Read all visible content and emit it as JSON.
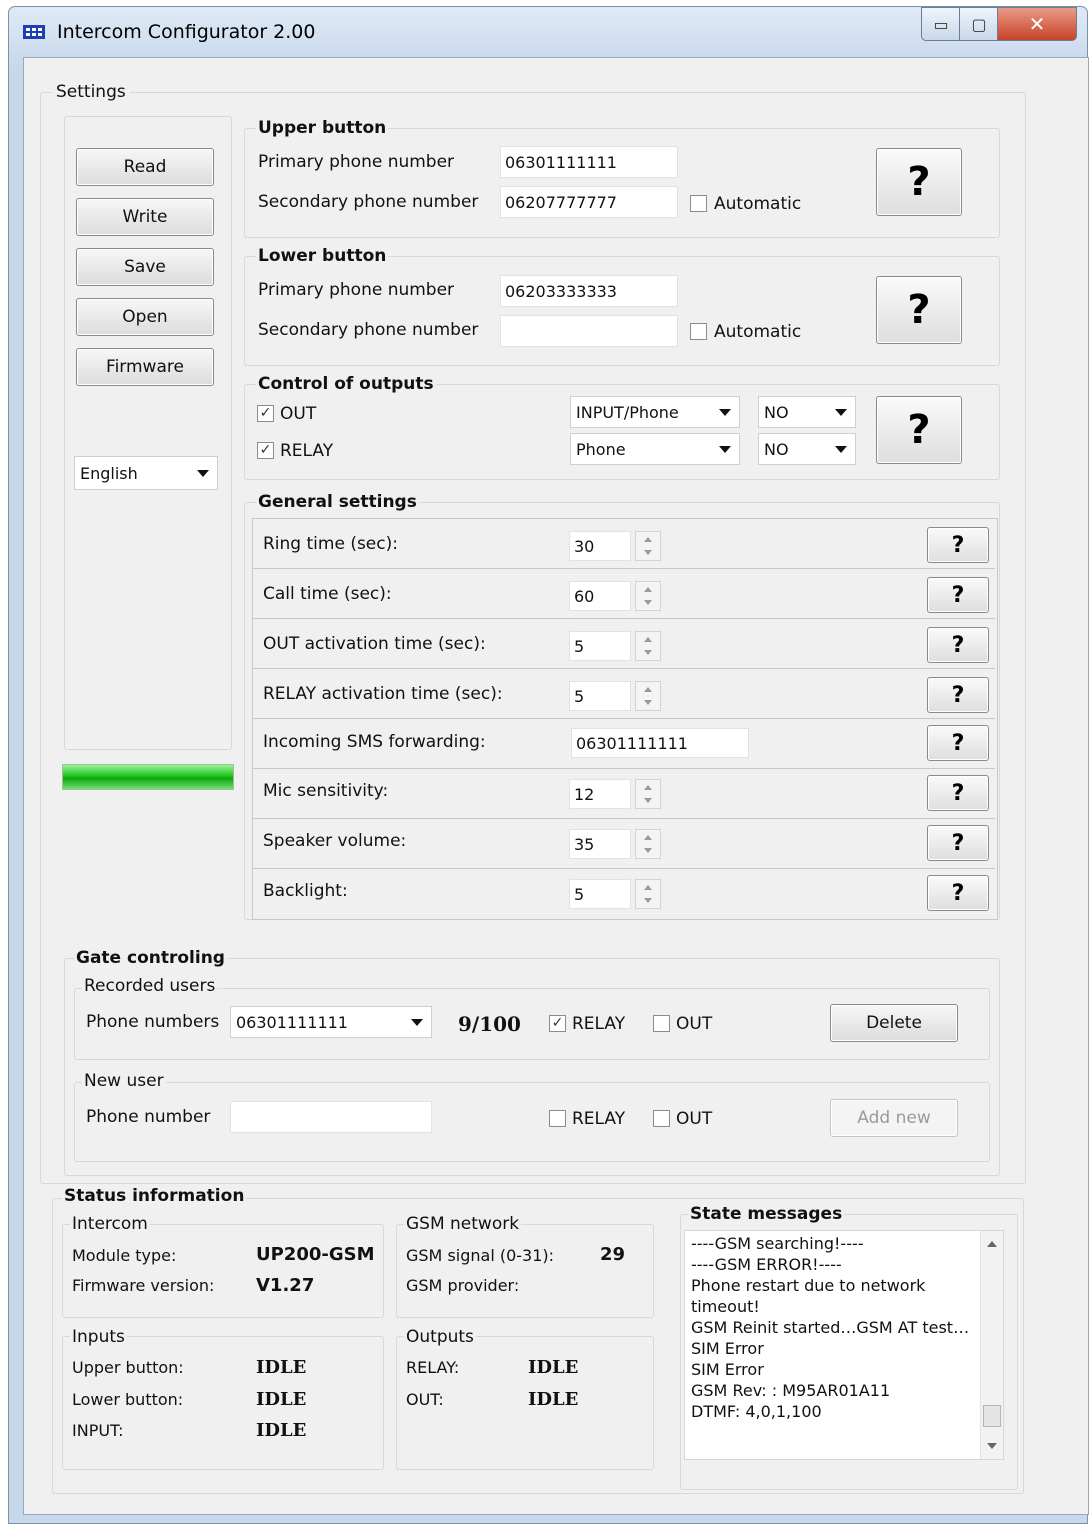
{
  "window": {
    "title": "Intercom Configurator 2.00",
    "min_glyph": "▭",
    "max_glyph": "▢",
    "close_glyph": "✕"
  },
  "settings": {
    "title": "Settings",
    "buttons": {
      "read": "Read",
      "write": "Write",
      "save": "Save",
      "open": "Open",
      "firmware": "Firmware"
    },
    "language": "English"
  },
  "upper_button": {
    "title": "Upper button",
    "primary_label": "Primary phone number",
    "primary_value": "06301111111",
    "secondary_label": "Secondary phone number",
    "secondary_value": "06207777777",
    "automatic_label": "Automatic",
    "automatic_checked": false,
    "help": "?"
  },
  "lower_button": {
    "title": "Lower button",
    "primary_label": "Primary phone number",
    "primary_value": "06203333333",
    "secondary_label": "Secondary phone number",
    "secondary_value": "",
    "automatic_label": "Automatic",
    "automatic_checked": false,
    "help": "?"
  },
  "outputs": {
    "title": "Control of outputs",
    "out": {
      "label": "OUT",
      "checked": true,
      "mode": "INPUT/Phone",
      "contact": "NO"
    },
    "relay": {
      "label": "RELAY",
      "checked": true,
      "mode": "Phone",
      "contact": "NO"
    },
    "help": "?"
  },
  "general": {
    "title": "General settings",
    "rows": [
      {
        "label": "Ring time (sec):",
        "value": "30"
      },
      {
        "label": "Call time (sec):",
        "value": "60"
      },
      {
        "label": "OUT activation time (sec):",
        "value": "5"
      },
      {
        "label": "RELAY activation time (sec):",
        "value": "5"
      },
      {
        "label": "Incoming SMS forwarding:",
        "value": "06301111111"
      },
      {
        "label": "Mic sensitivity:",
        "value": "12"
      },
      {
        "label": "Speaker volume:",
        "value": "35"
      },
      {
        "label": "Backlight:",
        "value": "5"
      }
    ],
    "help": "?"
  },
  "progress": {
    "value": 1.0
  },
  "gate": {
    "title": "Gate controling",
    "recorded": {
      "title": "Recorded users",
      "label": "Phone numbers",
      "selected": "06301111111",
      "count": "9/100",
      "relay_label": "RELAY",
      "relay_checked": true,
      "out_label": "OUT",
      "out_checked": false,
      "delete": "Delete"
    },
    "new_user": {
      "title": "New user",
      "label": "Phone number",
      "value": "",
      "relay_label": "RELAY",
      "relay_checked": false,
      "out_label": "OUT",
      "out_checked": false,
      "add": "Add new"
    }
  },
  "status": {
    "title": "Status information",
    "intercom": {
      "title": "Intercom",
      "module_label": "Module type:",
      "module_value": "UP200-GSM",
      "fw_label": "Firmware version:",
      "fw_value": "V1.27"
    },
    "gsm": {
      "title": "GSM network",
      "signal_label": "GSM signal (0-31):",
      "signal_value": "29",
      "provider_label": "GSM provider:",
      "provider_value": ""
    },
    "inputs": {
      "title": "Inputs",
      "upper_label": "Upper button:",
      "upper_value": "IDLE",
      "lower_label": "Lower button:",
      "lower_value": "IDLE",
      "input_label": "INPUT:",
      "input_value": "IDLE"
    },
    "outputs": {
      "title": "Outputs",
      "relay_label": "RELAY:",
      "relay_value": "IDLE",
      "out_label": "OUT:",
      "out_value": "IDLE"
    },
    "messages": {
      "title": "State messages",
      "lines": [
        "----GSM searching!----",
        "----GSM ERROR!----",
        "Phone restart due to network",
        "timeout!",
        "GSM Reinit started…GSM AT test…",
        "SIM Error",
        "SIM Error",
        "GSM Rev: : M95AR01A11",
        "DTMF:  4,0,1,100"
      ]
    }
  },
  "colors": {
    "progress": "#21c61f",
    "client_bg": "#f0f0f0",
    "frame": "#c7d8ec"
  }
}
